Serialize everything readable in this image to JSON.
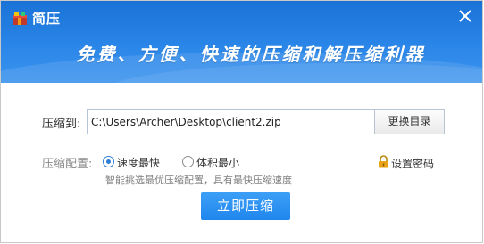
{
  "window": {
    "title": "简压",
    "slogan": "免费、方便、快速的压缩和解压缩利器"
  },
  "compress_to": {
    "label": "压缩到:",
    "path_value": "C:\\Users\\Archer\\Desktop\\client2.zip",
    "change_dir_label": "更换目录"
  },
  "config": {
    "label": "压缩配置:",
    "options": [
      {
        "label": "速度最快",
        "checked": true
      },
      {
        "label": "体积最小",
        "checked": false
      }
    ],
    "hint": "智能挑选最优压缩配置，具有最快压缩速度",
    "set_password_label": "设置密码"
  },
  "action": {
    "compress_label": "立即压缩"
  },
  "colors": {
    "header_blue": "#2a86e8",
    "accent": "#2b7fd8",
    "lock_gold": "#e8a317"
  },
  "icons": {
    "app": "app-icon",
    "close": "close-icon",
    "lock": "lock-icon"
  }
}
